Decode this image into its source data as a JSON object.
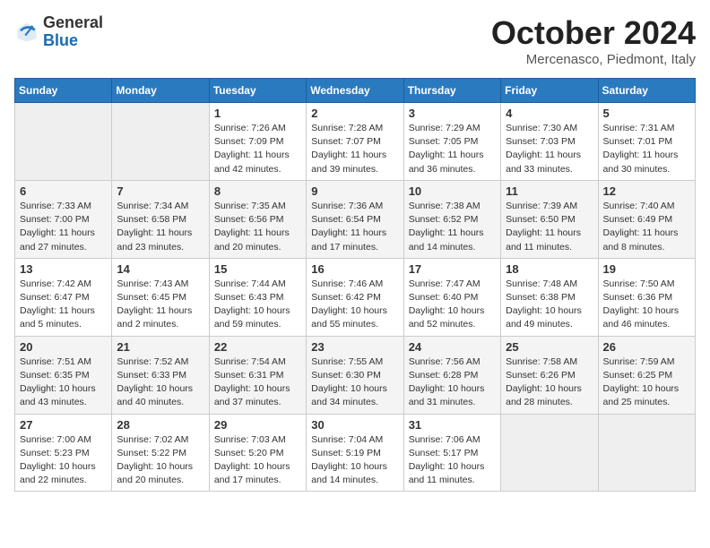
{
  "header": {
    "logo_general": "General",
    "logo_blue": "Blue",
    "month": "October 2024",
    "location": "Mercenasco, Piedmont, Italy"
  },
  "days_of_week": [
    "Sunday",
    "Monday",
    "Tuesday",
    "Wednesday",
    "Thursday",
    "Friday",
    "Saturday"
  ],
  "weeks": [
    [
      {
        "day": null
      },
      {
        "day": null
      },
      {
        "day": 1,
        "sunrise": "Sunrise: 7:26 AM",
        "sunset": "Sunset: 7:09 PM",
        "daylight": "Daylight: 11 hours and 42 minutes."
      },
      {
        "day": 2,
        "sunrise": "Sunrise: 7:28 AM",
        "sunset": "Sunset: 7:07 PM",
        "daylight": "Daylight: 11 hours and 39 minutes."
      },
      {
        "day": 3,
        "sunrise": "Sunrise: 7:29 AM",
        "sunset": "Sunset: 7:05 PM",
        "daylight": "Daylight: 11 hours and 36 minutes."
      },
      {
        "day": 4,
        "sunrise": "Sunrise: 7:30 AM",
        "sunset": "Sunset: 7:03 PM",
        "daylight": "Daylight: 11 hours and 33 minutes."
      },
      {
        "day": 5,
        "sunrise": "Sunrise: 7:31 AM",
        "sunset": "Sunset: 7:01 PM",
        "daylight": "Daylight: 11 hours and 30 minutes."
      }
    ],
    [
      {
        "day": 6,
        "sunrise": "Sunrise: 7:33 AM",
        "sunset": "Sunset: 7:00 PM",
        "daylight": "Daylight: 11 hours and 27 minutes."
      },
      {
        "day": 7,
        "sunrise": "Sunrise: 7:34 AM",
        "sunset": "Sunset: 6:58 PM",
        "daylight": "Daylight: 11 hours and 23 minutes."
      },
      {
        "day": 8,
        "sunrise": "Sunrise: 7:35 AM",
        "sunset": "Sunset: 6:56 PM",
        "daylight": "Daylight: 11 hours and 20 minutes."
      },
      {
        "day": 9,
        "sunrise": "Sunrise: 7:36 AM",
        "sunset": "Sunset: 6:54 PM",
        "daylight": "Daylight: 11 hours and 17 minutes."
      },
      {
        "day": 10,
        "sunrise": "Sunrise: 7:38 AM",
        "sunset": "Sunset: 6:52 PM",
        "daylight": "Daylight: 11 hours and 14 minutes."
      },
      {
        "day": 11,
        "sunrise": "Sunrise: 7:39 AM",
        "sunset": "Sunset: 6:50 PM",
        "daylight": "Daylight: 11 hours and 11 minutes."
      },
      {
        "day": 12,
        "sunrise": "Sunrise: 7:40 AM",
        "sunset": "Sunset: 6:49 PM",
        "daylight": "Daylight: 11 hours and 8 minutes."
      }
    ],
    [
      {
        "day": 13,
        "sunrise": "Sunrise: 7:42 AM",
        "sunset": "Sunset: 6:47 PM",
        "daylight": "Daylight: 11 hours and 5 minutes."
      },
      {
        "day": 14,
        "sunrise": "Sunrise: 7:43 AM",
        "sunset": "Sunset: 6:45 PM",
        "daylight": "Daylight: 11 hours and 2 minutes."
      },
      {
        "day": 15,
        "sunrise": "Sunrise: 7:44 AM",
        "sunset": "Sunset: 6:43 PM",
        "daylight": "Daylight: 10 hours and 59 minutes."
      },
      {
        "day": 16,
        "sunrise": "Sunrise: 7:46 AM",
        "sunset": "Sunset: 6:42 PM",
        "daylight": "Daylight: 10 hours and 55 minutes."
      },
      {
        "day": 17,
        "sunrise": "Sunrise: 7:47 AM",
        "sunset": "Sunset: 6:40 PM",
        "daylight": "Daylight: 10 hours and 52 minutes."
      },
      {
        "day": 18,
        "sunrise": "Sunrise: 7:48 AM",
        "sunset": "Sunset: 6:38 PM",
        "daylight": "Daylight: 10 hours and 49 minutes."
      },
      {
        "day": 19,
        "sunrise": "Sunrise: 7:50 AM",
        "sunset": "Sunset: 6:36 PM",
        "daylight": "Daylight: 10 hours and 46 minutes."
      }
    ],
    [
      {
        "day": 20,
        "sunrise": "Sunrise: 7:51 AM",
        "sunset": "Sunset: 6:35 PM",
        "daylight": "Daylight: 10 hours and 43 minutes."
      },
      {
        "day": 21,
        "sunrise": "Sunrise: 7:52 AM",
        "sunset": "Sunset: 6:33 PM",
        "daylight": "Daylight: 10 hours and 40 minutes."
      },
      {
        "day": 22,
        "sunrise": "Sunrise: 7:54 AM",
        "sunset": "Sunset: 6:31 PM",
        "daylight": "Daylight: 10 hours and 37 minutes."
      },
      {
        "day": 23,
        "sunrise": "Sunrise: 7:55 AM",
        "sunset": "Sunset: 6:30 PM",
        "daylight": "Daylight: 10 hours and 34 minutes."
      },
      {
        "day": 24,
        "sunrise": "Sunrise: 7:56 AM",
        "sunset": "Sunset: 6:28 PM",
        "daylight": "Daylight: 10 hours and 31 minutes."
      },
      {
        "day": 25,
        "sunrise": "Sunrise: 7:58 AM",
        "sunset": "Sunset: 6:26 PM",
        "daylight": "Daylight: 10 hours and 28 minutes."
      },
      {
        "day": 26,
        "sunrise": "Sunrise: 7:59 AM",
        "sunset": "Sunset: 6:25 PM",
        "daylight": "Daylight: 10 hours and 25 minutes."
      }
    ],
    [
      {
        "day": 27,
        "sunrise": "Sunrise: 7:00 AM",
        "sunset": "Sunset: 5:23 PM",
        "daylight": "Daylight: 10 hours and 22 minutes."
      },
      {
        "day": 28,
        "sunrise": "Sunrise: 7:02 AM",
        "sunset": "Sunset: 5:22 PM",
        "daylight": "Daylight: 10 hours and 20 minutes."
      },
      {
        "day": 29,
        "sunrise": "Sunrise: 7:03 AM",
        "sunset": "Sunset: 5:20 PM",
        "daylight": "Daylight: 10 hours and 17 minutes."
      },
      {
        "day": 30,
        "sunrise": "Sunrise: 7:04 AM",
        "sunset": "Sunset: 5:19 PM",
        "daylight": "Daylight: 10 hours and 14 minutes."
      },
      {
        "day": 31,
        "sunrise": "Sunrise: 7:06 AM",
        "sunset": "Sunset: 5:17 PM",
        "daylight": "Daylight: 10 hours and 11 minutes."
      },
      {
        "day": null
      },
      {
        "day": null
      }
    ]
  ]
}
